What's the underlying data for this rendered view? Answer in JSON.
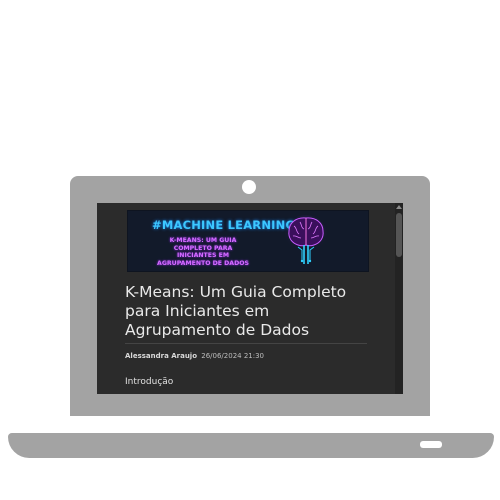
{
  "banner": {
    "title": "#MACHINE LEARNING",
    "subtitle": "K-MEANS: UM GUIA COMPLETO PARA INICIANTES EM AGRUPAMENTO DE DADOS",
    "icon": "brain-icon"
  },
  "article": {
    "title": "K-Means: Um Guia Completo para Iniciantes em Agrupamento de Dados",
    "author": "Alessandra Araujo",
    "date": "26/06/2024 21:30",
    "section_heading": "Introdução"
  },
  "colors": {
    "device": "#a3a3a3",
    "screen_bg": "#2b2b2b",
    "banner_title": "#3cc8ff",
    "banner_subtitle": "#d66cff"
  }
}
